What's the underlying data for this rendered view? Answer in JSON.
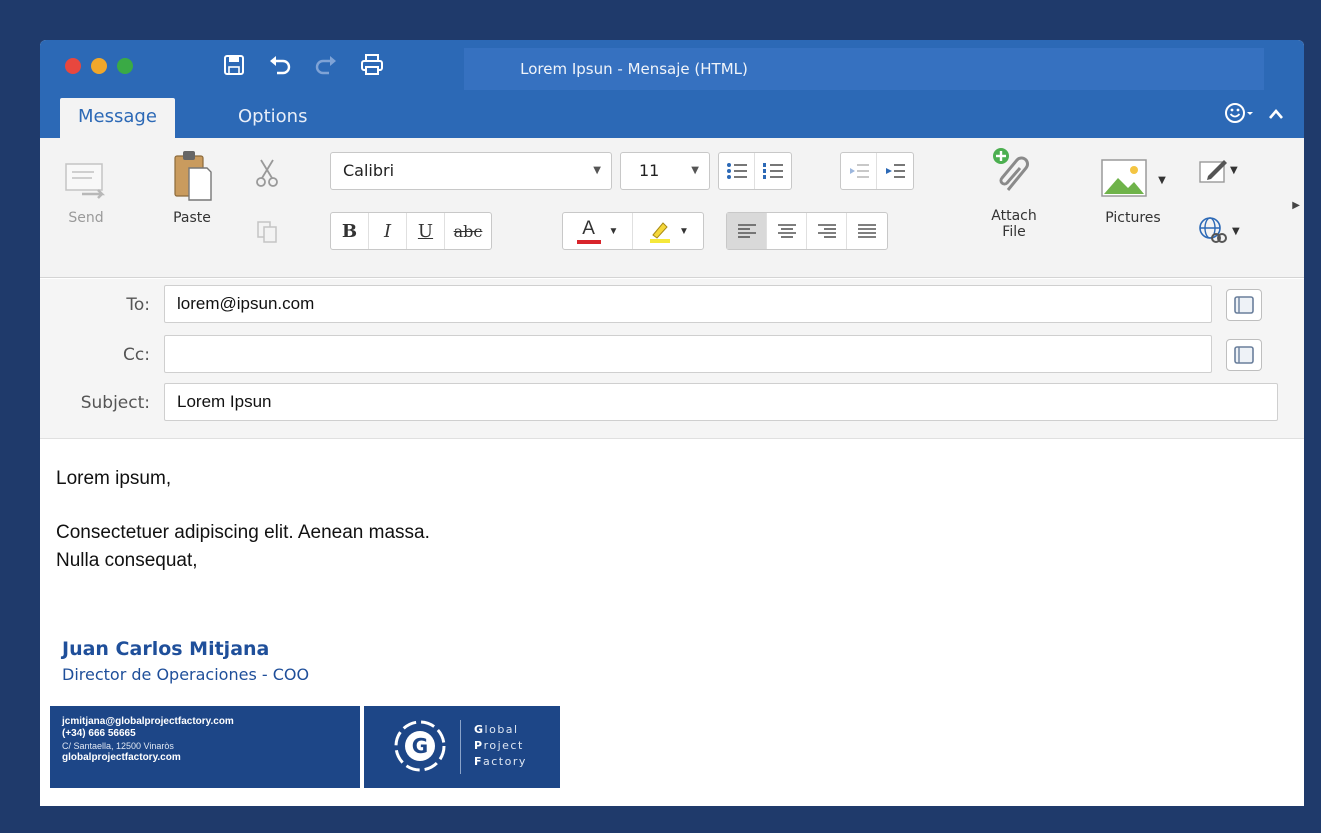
{
  "window": {
    "title": "Lorem Ipsun - Mensaje (HTML)"
  },
  "tabs": {
    "message": "Message",
    "options": "Options"
  },
  "ribbon": {
    "send_label": "Send",
    "paste_label": "Paste",
    "font_name": "Calibri",
    "font_size": "11",
    "bold": "B",
    "italic": "I",
    "underline": "U",
    "strikethrough": "abc",
    "font_color_glyph": "A",
    "attach_label_1": "Attach",
    "attach_label_2": "File",
    "pictures_label": "Pictures"
  },
  "fields": {
    "to_label": "To:",
    "to_value": "lorem@ipsun.com",
    "cc_label": "Cc:",
    "cc_value": "",
    "subject_label": "Subject:",
    "subject_value": "Lorem Ipsun"
  },
  "body": {
    "greeting": "Lorem ipsum,",
    "line1": "Consectetuer adipiscing elit. Aenean massa.",
    "line2": "Nulla consequat,"
  },
  "signature": {
    "name": "Juan Carlos Mitjana",
    "title": "Director de Operaciones - COO",
    "email": "jcmitjana@globalprojectfactory.com",
    "phone": "(+34) 666 56665",
    "address": "C/ Santaella, 12500 Vinaròs",
    "website": "globalprojectfactory.com",
    "logo_letter": "G",
    "logo_line1_initial": "G",
    "logo_line1_rest": "lobal",
    "logo_line2_initial": "P",
    "logo_line2_rest": "roject",
    "logo_line3_initial": "F",
    "logo_line3_rest": "actory"
  },
  "icons": {
    "save": "save-icon",
    "undo": "undo-icon",
    "redo": "redo-icon",
    "print": "print-icon",
    "smiley": "smiley-icon",
    "collapse": "chevron-up-icon",
    "address_book": "address-book-icon"
  },
  "colors": {
    "accent": "#2c69b6",
    "background": "#1f3a6b",
    "signature": "#1d4687"
  }
}
